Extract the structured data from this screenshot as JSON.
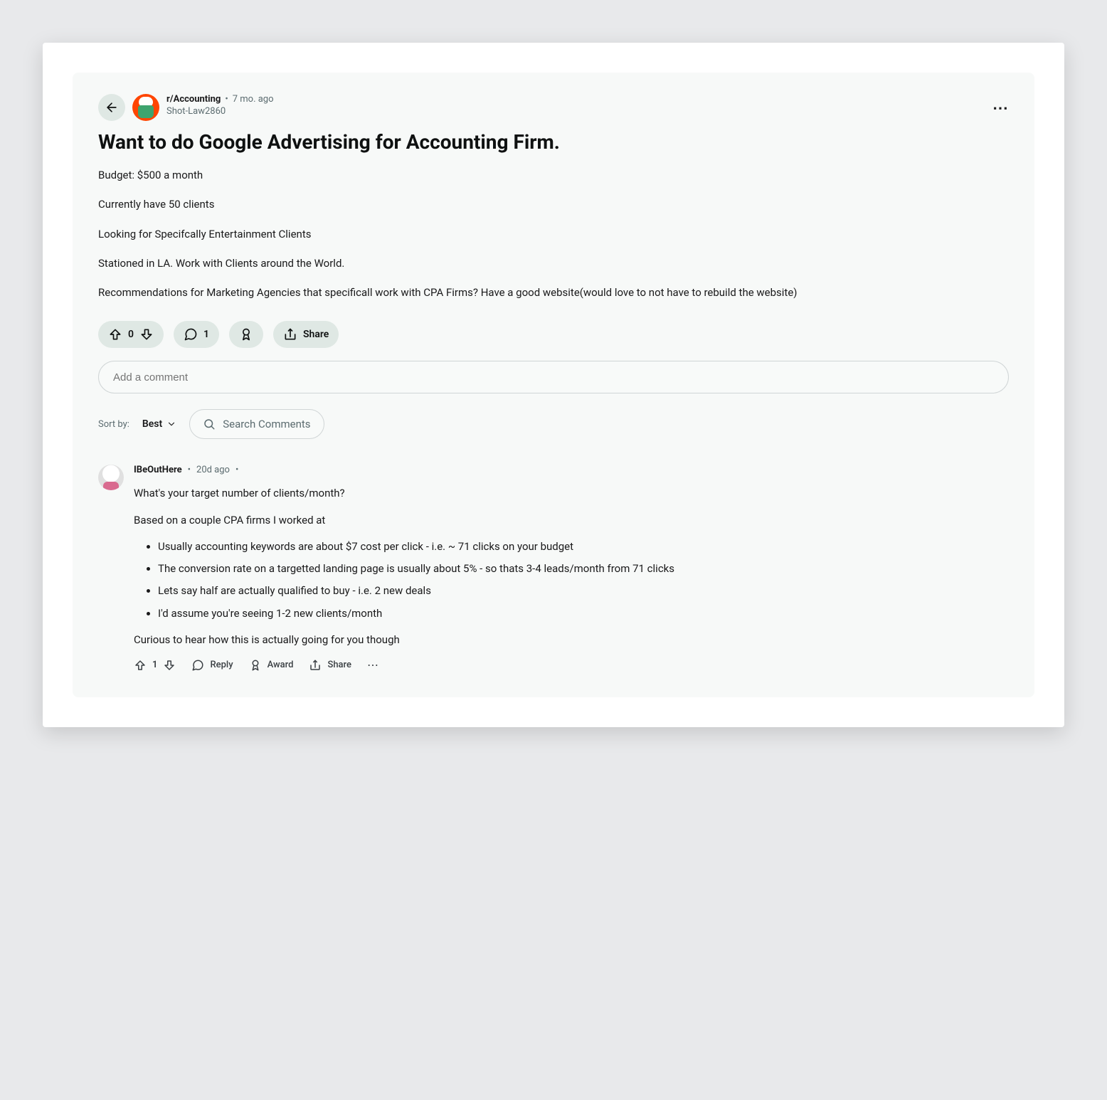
{
  "post": {
    "subreddit": "r/Accounting",
    "age": "7 mo. ago",
    "author": "Shot-Law2860",
    "title": "Want to do Google Advertising for Accounting Firm.",
    "body": [
      "Budget: $500 a month",
      "Currently have 50 clients",
      "Looking for Specifcally Entertainment Clients",
      "Stationed in LA. Work with Clients around the World.",
      "Recommendations for Marketing Agencies that specificall work with CPA Firms? Have a good website(would love to not have to rebuild the website)"
    ],
    "vote_score": "0",
    "comments_count": "1",
    "share_label": "Share",
    "comment_placeholder": "Add a comment"
  },
  "sort": {
    "label": "Sort by:",
    "value": "Best",
    "search_placeholder": "Search Comments"
  },
  "comment": {
    "author": "IBeOutHere",
    "age": "20d ago",
    "p1": "What's your target number of clients/month?",
    "p2": "Based on a couple CPA firms I worked at",
    "bullets": [
      "Usually accounting keywords are about $7 cost per click - i.e. ~ 71 clicks on your budget",
      "The conversion rate on a targetted landing page is usually about 5% - so thats 3-4 leads/month from 71 clicks",
      "Lets say half are actually qualified to buy - i.e. 2 new deals",
      "I'd assume you're seeing 1-2 new clients/month"
    ],
    "p3": "Curious to hear how this is actually going for you though",
    "score": "1",
    "reply_label": "Reply",
    "award_label": "Award",
    "share_label": "Share"
  }
}
